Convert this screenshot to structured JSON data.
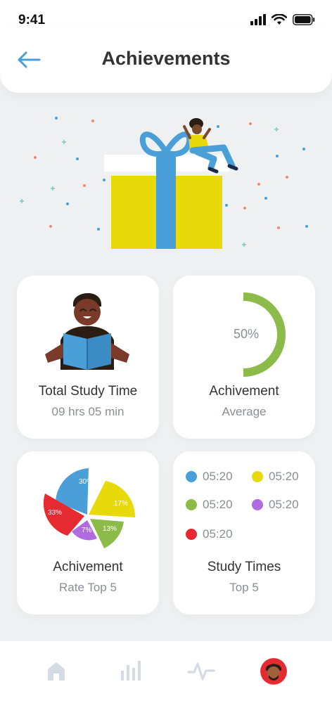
{
  "status_bar": {
    "time": "9:41"
  },
  "header": {
    "title": "Achievements"
  },
  "cards": {
    "study_time": {
      "title": "Total Study Time",
      "subtitle": "09 hrs 05 min"
    },
    "achievement_avg": {
      "title": "Achivement",
      "subtitle": "Average",
      "gauge_value": "50%",
      "gauge_fraction": 0.5
    },
    "achievement_rate": {
      "title": "Achivement",
      "subtitle": "Rate Top 5",
      "slices": [
        {
          "label": "30%",
          "color": "#4a9fd8"
        },
        {
          "label": "17%",
          "color": "#e8d90a"
        },
        {
          "label": "13%",
          "color": "#8dbb4a"
        },
        {
          "label": "7%",
          "color": "#b06be0"
        },
        {
          "label": "33%",
          "color": "#e62a32"
        }
      ]
    },
    "study_times": {
      "title": "Study Times",
      "subtitle": "Top 5",
      "items": [
        {
          "value": "05:20",
          "color": "#4a9fd8"
        },
        {
          "value": "05:20",
          "color": "#e8d90a"
        },
        {
          "value": "05:20",
          "color": "#8dbb4a"
        },
        {
          "value": "05:20",
          "color": "#b06be0"
        },
        {
          "value": "05:20",
          "color": "#e62a32"
        }
      ]
    }
  },
  "colors": {
    "accent": "#4a9fd8",
    "gift_yellow": "#e8d90a",
    "gauge_green": "#8dbb4a"
  },
  "bottom_nav": {
    "items": [
      "home-icon",
      "bar-chart-icon",
      "activity-icon",
      "profile-avatar"
    ]
  }
}
